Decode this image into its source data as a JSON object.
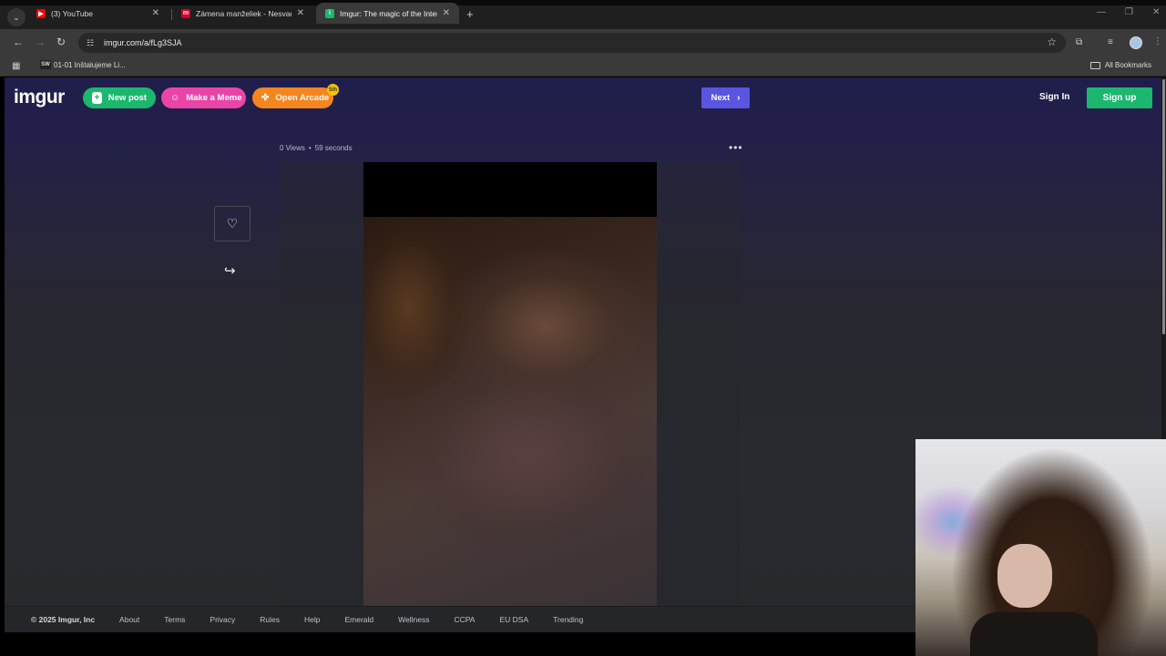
{
  "browser": {
    "tabs": [
      {
        "title": "(3) YouTube",
        "favicon": "youtube-icon",
        "color": "#ff0000"
      },
      {
        "title": "Zámena manželiek - Nesvady/N",
        "favicon": "markiza-icon",
        "color": "#d6002a"
      },
      {
        "title": "Imgur: The magic of the Interne",
        "favicon": "imgur-icon",
        "color": "#1bb76e",
        "active": true
      }
    ],
    "url": "imgur.com/a/fLg3SJA",
    "bookmarks": [
      {
        "label": "01-01 Inštalujeme Li...",
        "favicon_text": "SW"
      }
    ],
    "all_bookmarks": "All Bookmarks"
  },
  "imgur": {
    "logo": "imgur",
    "new_post": "New post",
    "make_meme": "Make a Meme",
    "open_arcade": "Open Arcade",
    "arcade_badge": "5th",
    "next": "Next",
    "sign_in": "Sign In",
    "sign_up": "Sign up",
    "views": "0 Views",
    "duration": "59 seconds"
  },
  "footer": {
    "copyright": "© 2025 Imgur, Inc",
    "links": [
      "About",
      "Terms",
      "Privacy",
      "Rules",
      "Help",
      "Emerald",
      "Wellness",
      "CCPA",
      "EU DSA",
      "Trending"
    ]
  },
  "colors": {
    "brand_green": "#1bb76e",
    "meme_pink": "#e944a6",
    "arcade_orange": "#f5851f",
    "next_purple": "#5a55e0"
  }
}
